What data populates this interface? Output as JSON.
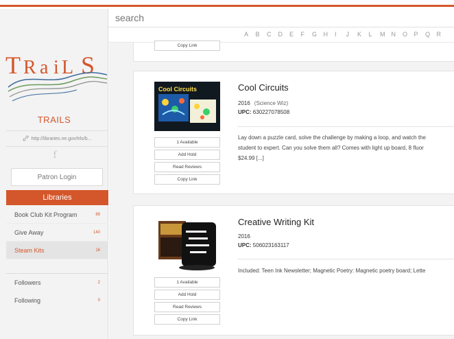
{
  "search": {
    "placeholder": "search"
  },
  "alphabet": [
    "A",
    "B",
    "C",
    "D",
    "E",
    "F",
    "G",
    "H",
    "I",
    "J",
    "K",
    "L",
    "M",
    "N",
    "O",
    "P",
    "Q",
    "R"
  ],
  "sidebar": {
    "logo_text": "TRaiLS",
    "site_name": "TRAILS",
    "url": "http://libraries.ne.gov/trls/b...",
    "patron_login": "Patron Login",
    "libraries_header": "Libraries",
    "libraries": [
      {
        "label": "Book Club Kit Program",
        "count": "89"
      },
      {
        "label": "Give Away",
        "count": "140"
      },
      {
        "label": "Steam Kits",
        "count": "16"
      }
    ],
    "follow": [
      {
        "label": "Followers",
        "count": "2"
      },
      {
        "label": "Following",
        "count": "0"
      }
    ]
  },
  "partial_card": {
    "copy_link": "Copy Link"
  },
  "items": [
    {
      "title": "Cool Circuits",
      "year": "2016",
      "publisher": "(Science Wiz)",
      "upc_label": "UPC:",
      "upc": "630227078508",
      "desc_lines": [
        "Lay down a puzzle card, solve the challenge by making a loop, and watch the",
        "student to expert. Can you solve them all? Comes with light up board, 8 fluor",
        "$24.99 [...]"
      ],
      "thumb_text": "Cool Circuits",
      "buttons": [
        "1 Available",
        "Add Hold",
        "Read Reviews",
        "Copy Link"
      ]
    },
    {
      "title": "Creative Writing Kit",
      "year": "2016",
      "publisher": "",
      "upc_label": "UPC:",
      "upc": "506023163117",
      "desc_lines": [
        "Included: Teen Ink Newsletter; Magnetic Poetry: Magnetic poetry board; Lette"
      ],
      "thumb_text": "",
      "buttons": [
        "1 Available",
        "Add Hold",
        "Read Reviews",
        "Copy Link"
      ]
    }
  ],
  "colors": {
    "accent": "#d4562b",
    "logo_blue": "#3a6a9a",
    "logo_green": "#6a9a5a"
  }
}
